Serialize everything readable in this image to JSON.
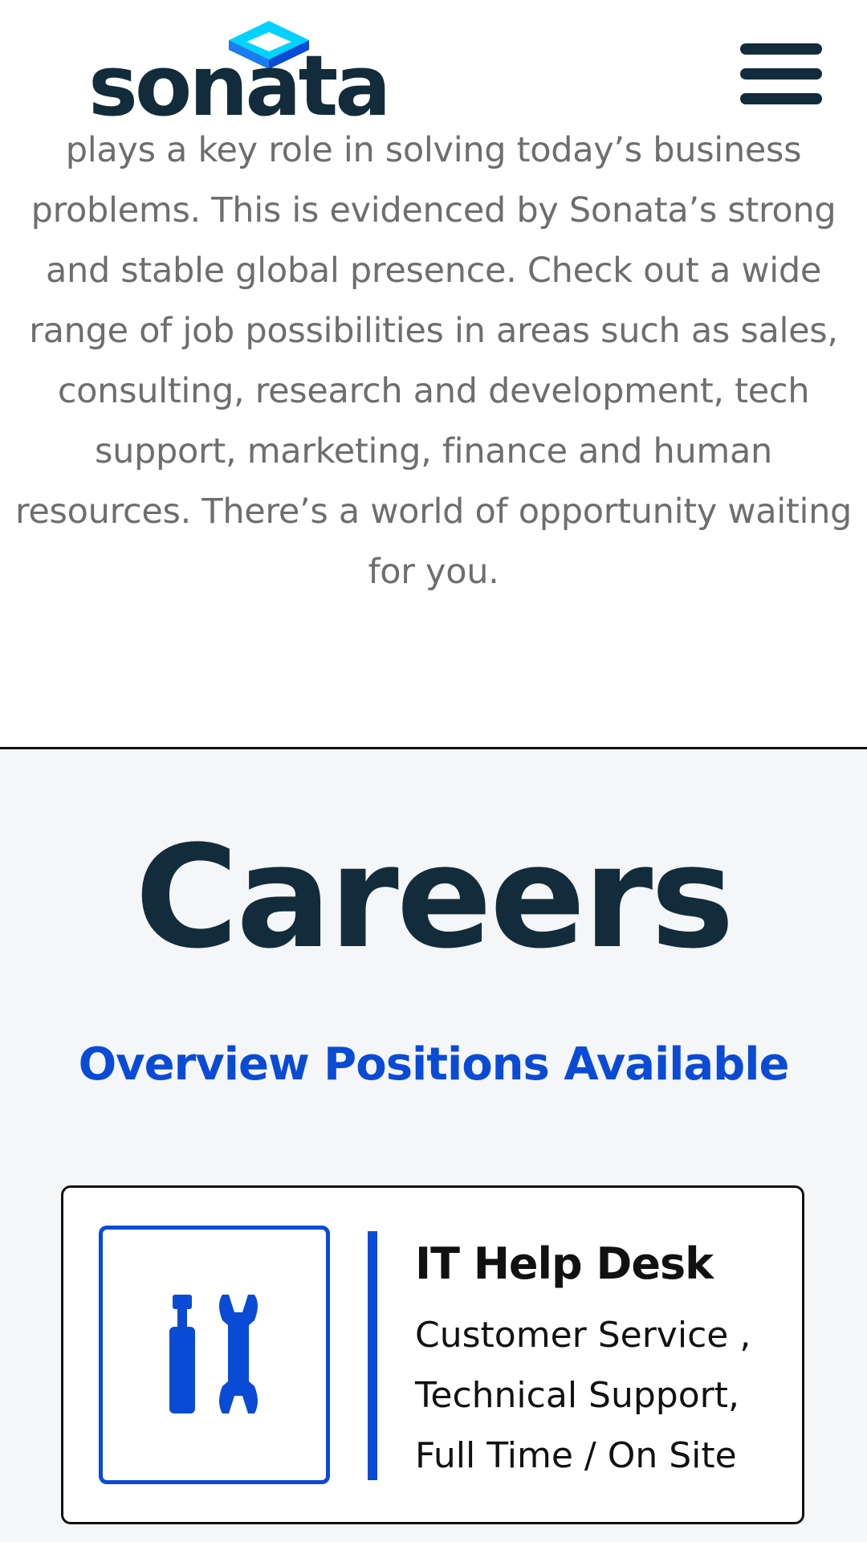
{
  "header": {
    "logo_text": "sonata",
    "logo_icon": "sonata-diamond-icon",
    "menu_icon": "hamburger-menu-icon"
  },
  "intro": {
    "lines": [
      "plays a key role in solving today’s business",
      "problems. This is evidenced by Sonata’s strong",
      "and stable global presence. Check out a wide",
      "range of job possibilities in areas such as sales,",
      "consulting, research and development, tech",
      "support, marketing, finance and human",
      "resources. There’s a world of opportunity waiting",
      "for you."
    ]
  },
  "careers": {
    "title": "Careers",
    "subtitle": "Overview Positions Available",
    "jobs": [
      {
        "icon": "tools-icon",
        "title": "IT Help Desk",
        "meta_lines": [
          "Customer Service ,",
          "Technical Support,",
          "Full Time / On Site"
        ]
      }
    ]
  },
  "colors": {
    "brand_dark": "#132c3b",
    "accent_blue": "#0a4bd6",
    "logo_cyan": "#00d2ff",
    "text_gray": "#6e6e6e",
    "section_bg": "#f5f6f8"
  }
}
